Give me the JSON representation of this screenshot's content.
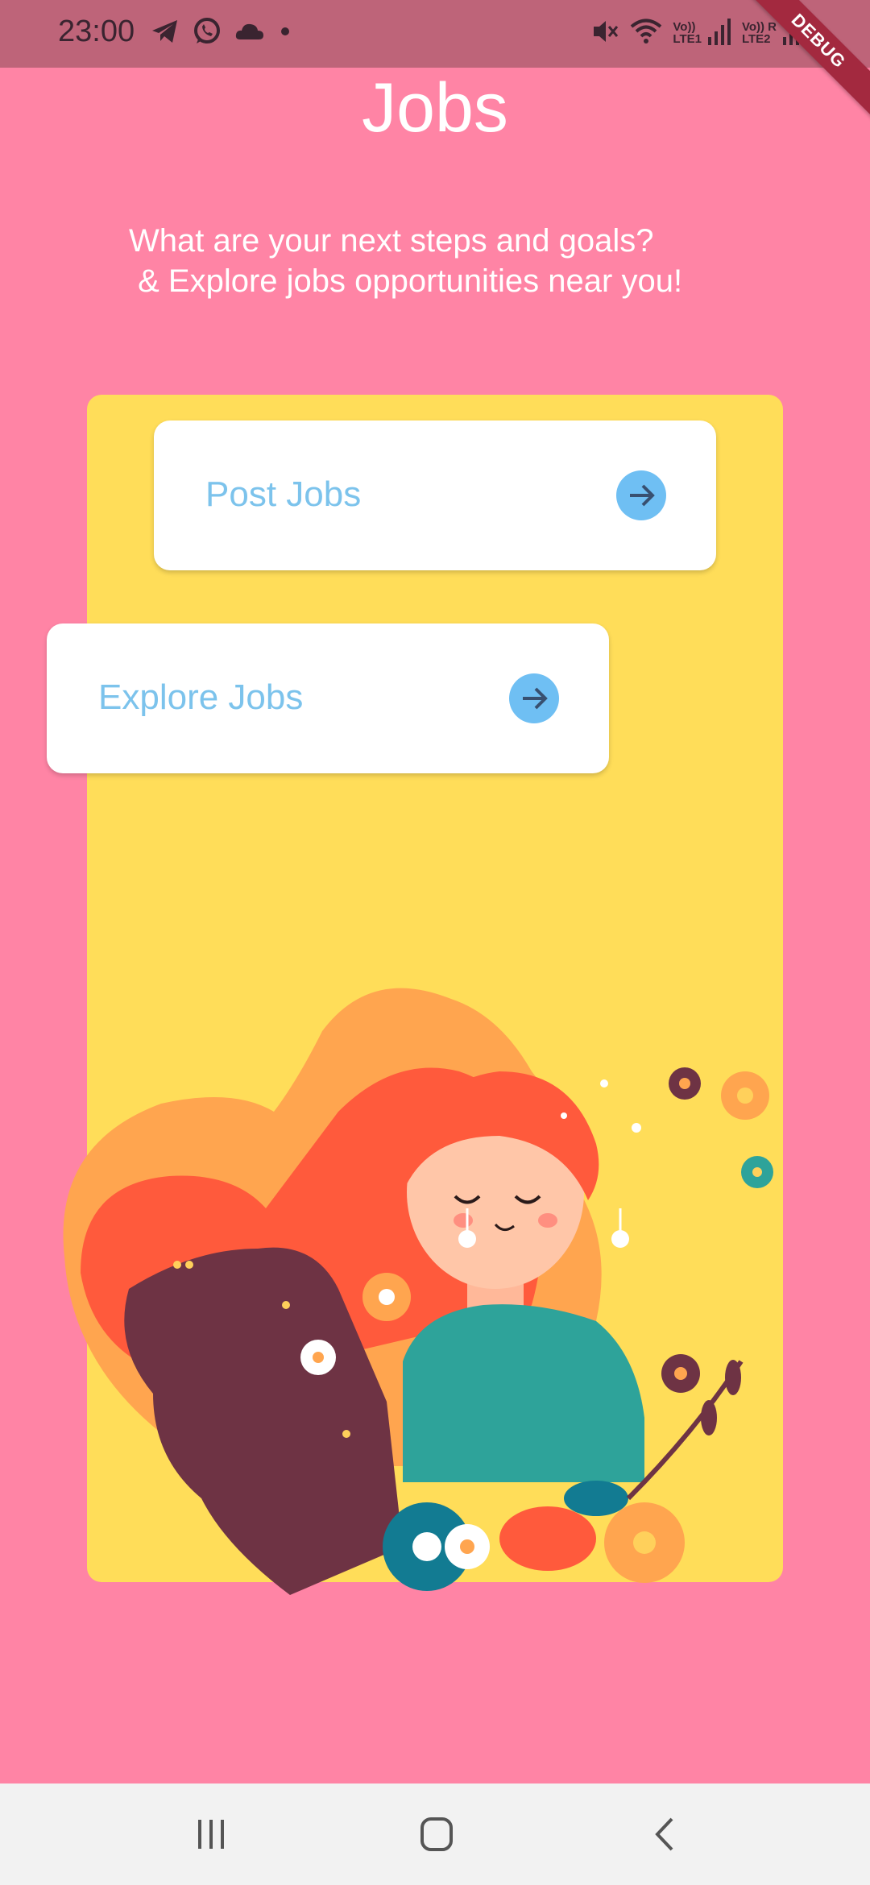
{
  "status_bar": {
    "time": "23:00",
    "icons_left": [
      "telegram-icon",
      "whatsapp-icon",
      "cloud-icon",
      "dot-icon"
    ],
    "icons_right": [
      "mute-icon",
      "wifi-icon",
      "signal-lte1-icon",
      "signal-lte2-icon"
    ],
    "net1_top": "Vo))",
    "net1_bottom": "LTE1",
    "net2_top": "Vo)) R",
    "net2_bottom": "LTE2",
    "debug_ribbon": "DEBUG"
  },
  "header": {
    "title": "Jobs",
    "subtitle": "What are your next steps and goals?\n & Explore jobs opportunities near you!"
  },
  "actions": {
    "post_jobs": {
      "label": "Post Jobs",
      "icon": "arrow-right-icon"
    },
    "explore_jobs": {
      "label": "Explore Jobs",
      "icon": "arrow-right-icon"
    }
  },
  "illustration": {
    "icon": "woman-with-flowers-illustration"
  },
  "colors": {
    "background": "#ff84a5",
    "status_bar": "#be6479",
    "card": "#ffdd59",
    "button_text": "#7cc3ec",
    "arrow_circle": "#6fbff3",
    "nav_bar": "#f2f2f2"
  },
  "nav_bar": {
    "recent": "recent-apps-icon",
    "home": "home-icon",
    "back": "back-icon"
  }
}
